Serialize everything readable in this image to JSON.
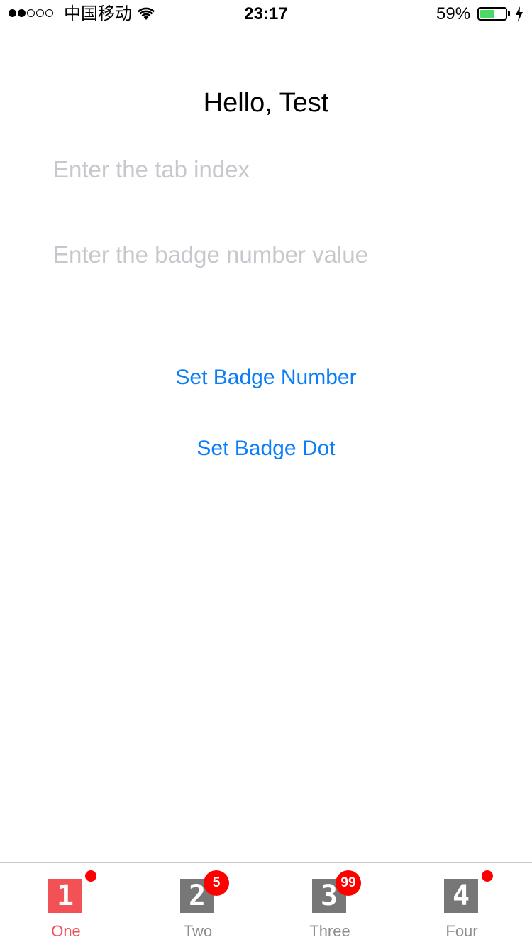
{
  "status_bar": {
    "carrier": "中国移动",
    "time": "23:17",
    "battery_percent": "59%",
    "battery_level": 0.59,
    "battery_color": "#4cd964",
    "signal_filled": 2,
    "signal_total": 5
  },
  "main": {
    "greeting": "Hello, Test",
    "tab_index_placeholder": "Enter the tab index",
    "badge_value_placeholder": "Enter the badge number value",
    "set_badge_number_label": "Set Badge Number",
    "set_badge_dot_label": "Set Badge Dot"
  },
  "tab_bar": {
    "active_color": "#f25255",
    "inactive_color": "#8e8e8e",
    "badge_color": "#ff0000",
    "tabs": [
      {
        "label": "One",
        "icon": "1",
        "badge_dot": true,
        "active": true
      },
      {
        "label": "Two",
        "icon": "2",
        "badge": "5"
      },
      {
        "label": "Three",
        "icon": "3",
        "badge": "99"
      },
      {
        "label": "Four",
        "icon": "4",
        "badge_dot": true
      }
    ]
  },
  "colors": {
    "link": "#0a7df8",
    "placeholder": "#c7c7cd"
  }
}
